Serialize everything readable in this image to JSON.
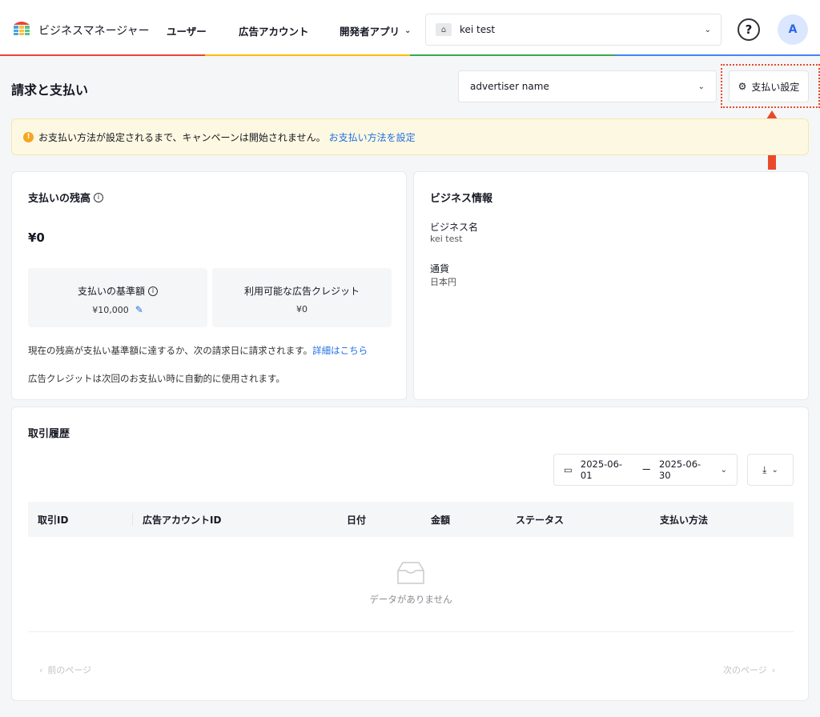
{
  "topbar": {
    "brand": "ビジネスマネージャー",
    "nav_users": "ユーザー",
    "nav_ad_accounts": "広告アカウント",
    "nav_dev_apps": "開発者アプリ",
    "account_name": "kei test",
    "avatar_initial": "A",
    "help_symbol": "?"
  },
  "page": {
    "title": "請求と支払い",
    "advertiser_select": "advertiser name",
    "payment_settings_label": "支払い設定"
  },
  "alert": {
    "message": "お支払い方法が設定されるまで、キャンペーンは開始されません。",
    "link": "お支払い方法を設定"
  },
  "balance_card": {
    "title": "支払いの残高",
    "amount": "¥0",
    "threshold_label": "支払いの基準額",
    "threshold_value": "¥10,000",
    "credit_label": "利用可能な広告クレジット",
    "credit_value": "¥0",
    "note1": "現在の残高が支払い基準額に達するか、次の請求日に請求されます。",
    "note1_link": "詳細はこちら",
    "note2": "広告クレジットは次回のお支払い時に自動的に使用されます。"
  },
  "business_card": {
    "title": "ビジネス情報",
    "name_label": "ビジネス名",
    "name_value": "kei test",
    "currency_label": "通貨",
    "currency_value": "日本円"
  },
  "history_card": {
    "title": "取引履歴",
    "date_start": "2025-06-01",
    "date_sep": "ー",
    "date_end": "2025-06-30",
    "columns": [
      "取引ID",
      "広告アカウントID",
      "日付",
      "金額",
      "ステータス",
      "支払い方法"
    ],
    "empty_text": "データがありません",
    "prev_page": "前のページ",
    "next_page": "次のページ"
  },
  "colors": {
    "accent_blue": "#1f6fe5",
    "alert_bg": "#fdf8e1",
    "annotation_red": "#e84a2c"
  }
}
